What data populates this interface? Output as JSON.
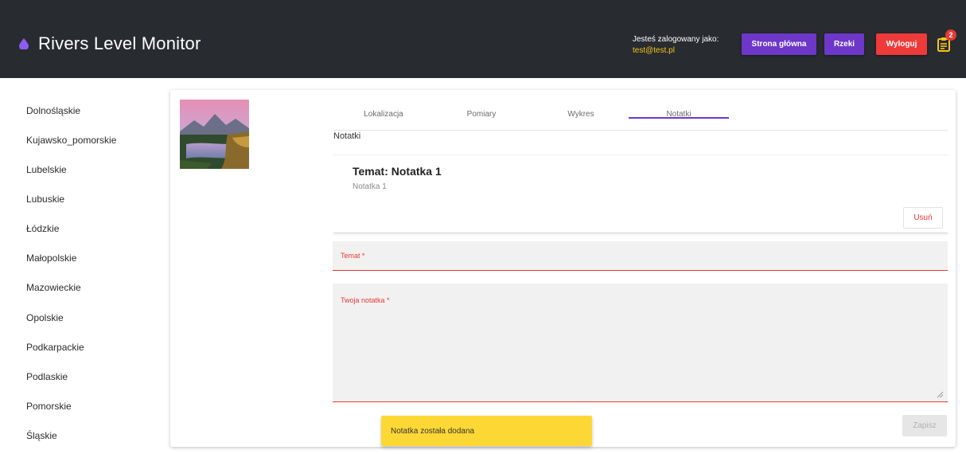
{
  "header": {
    "title": "Rivers Level Monitor",
    "logged_in_label": "Jesteś zalogowany jako:",
    "user_email": "test@test.pl",
    "home_button": "Strona główna",
    "rivers_button": "Rzeki",
    "logout_button": "Wyloguj",
    "notification_count": "2"
  },
  "sidebar": {
    "items": [
      {
        "label": "Dolnośląskie"
      },
      {
        "label": "Kujawsko_pomorskie"
      },
      {
        "label": "Lubelskie"
      },
      {
        "label": "Lubuskie"
      },
      {
        "label": "Łódzkie"
      },
      {
        "label": "Małopolskie"
      },
      {
        "label": "Mazowieckie"
      },
      {
        "label": "Opolskie"
      },
      {
        "label": "Podkarpackie"
      },
      {
        "label": "Podlaskie"
      },
      {
        "label": "Pomorskie"
      },
      {
        "label": "Śląskie"
      }
    ]
  },
  "tabs": [
    {
      "label": "Lokalizacja"
    },
    {
      "label": "Pomiary"
    },
    {
      "label": "Wykres"
    },
    {
      "label": "Notatki"
    }
  ],
  "notes": {
    "section_label": "Notatki",
    "items": [
      {
        "title": "Temat: Notatka 1",
        "body": "Notatka 1",
        "delete_label": "Usuń"
      }
    ]
  },
  "form": {
    "subject_label": "Temat *",
    "note_label": "Twoja notatka *",
    "save_label": "Zapisz"
  },
  "toast": {
    "message": "Notatka została dodana"
  },
  "colors": {
    "header_bg": "#282b30",
    "accent_purple": "#6d38c9",
    "danger_red": "#ef3a3a",
    "toast_yellow": "#fdd835",
    "email_gold": "#f5c518"
  }
}
